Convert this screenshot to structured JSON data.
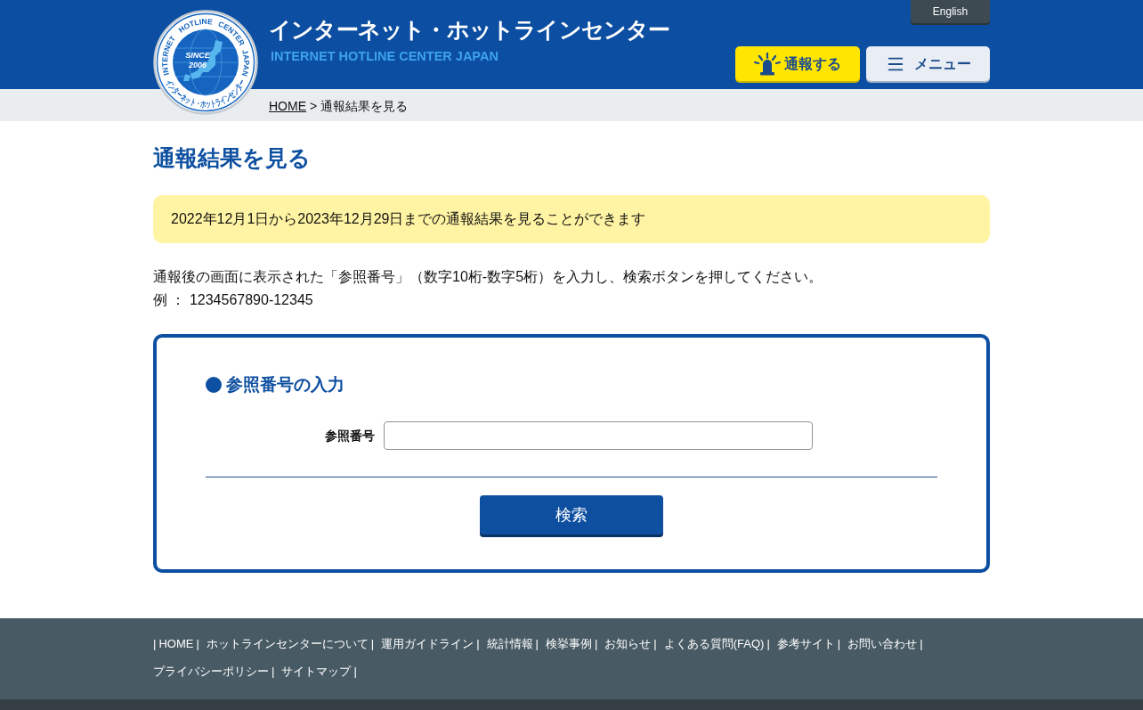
{
  "header": {
    "logo": {
      "ring_words_top": [
        "INTERNET",
        "HOTLINE",
        "CENTER",
        "JAPAN"
      ],
      "inner_lines": [
        "SINCE",
        "2006"
      ],
      "ring_text_bottom": "インターネット・ホットラインセンター"
    },
    "title": "インターネット・ホットラインセンター",
    "subtitle": "INTERNET HOTLINE CENTER JAPAN",
    "language_link": "English",
    "buttons": [
      {
        "kind": "report",
        "label": "通報する"
      },
      {
        "kind": "menu",
        "label": "メニュー"
      }
    ]
  },
  "breadcrumb": {
    "items": [
      {
        "label": "HOME",
        "link": true
      },
      {
        "label": "通報結果を見る",
        "link": false
      }
    ],
    "separator": ">"
  },
  "page_title": "通報結果を見る",
  "notice": "2022年12月1日から2023年12月29日までの通報結果を見ることができます",
  "instructions": [
    "通報後の画面に表示された「参照番号」（数字10桁-数字5桁）を入力し、検索ボタンを押してください。",
    "例 ： 1234567890-12345"
  ],
  "form": {
    "heading": "参照番号の入力",
    "field": {
      "label": "参照番号"
    },
    "submit": "検索"
  },
  "footer": {
    "leading_separator": "|",
    "links": [
      {
        "label": "HOME",
        "separator": "|"
      },
      {
        "label": "ホットラインセンターについて",
        "separator": "|"
      },
      {
        "label": "運用ガイドライン",
        "separator": "|"
      },
      {
        "label": "統計情報",
        "separator": "|"
      },
      {
        "label": "検挙事例",
        "separator": "|"
      },
      {
        "label": "お知らせ",
        "separator": "|"
      },
      {
        "label": "よくある質問(FAQ)",
        "separator": "|"
      },
      {
        "label": "参考サイト",
        "separator": "|"
      },
      {
        "label": "お問い合わせ",
        "separator": "|"
      },
      {
        "label": "プライバシーポリシー",
        "separator": "|"
      },
      {
        "label": "サイトマップ",
        "separator": "|"
      }
    ]
  }
}
